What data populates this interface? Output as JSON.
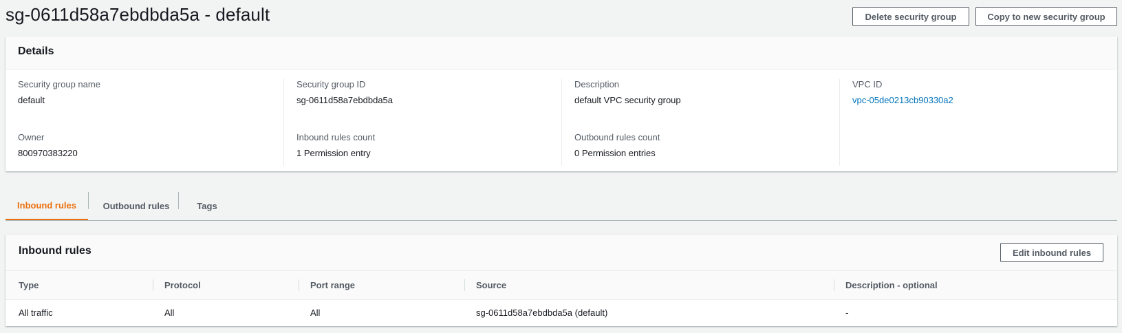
{
  "header": {
    "title": "sg-0611d58a7ebdbda5a - default",
    "delete_label": "Delete security group",
    "copy_label": "Copy to new security group"
  },
  "details": {
    "heading": "Details",
    "fields": {
      "sg_name": {
        "label": "Security group name",
        "value": "default"
      },
      "sg_id": {
        "label": "Security group ID",
        "value": "sg-0611d58a7ebdbda5a"
      },
      "description": {
        "label": "Description",
        "value": "default VPC security group"
      },
      "vpc_id": {
        "label": "VPC ID",
        "value": "vpc-05de0213cb90330a2"
      },
      "owner": {
        "label": "Owner",
        "value": "800970383220"
      },
      "inbound_count": {
        "label": "Inbound rules count",
        "value": "1 Permission entry"
      },
      "outbound_count": {
        "label": "Outbound rules count",
        "value": "0 Permission entries"
      }
    }
  },
  "tabs": [
    {
      "label": "Inbound rules",
      "active": true
    },
    {
      "label": "Outbound rules",
      "active": false
    },
    {
      "label": "Tags",
      "active": false
    }
  ],
  "inbound": {
    "heading": "Inbound rules",
    "edit_label": "Edit inbound rules",
    "columns": [
      "Type",
      "Protocol",
      "Port range",
      "Source",
      "Description - optional"
    ],
    "rows": [
      [
        "All traffic",
        "All",
        "All",
        "sg-0611d58a7ebdbda5a (default)",
        "-"
      ]
    ]
  },
  "colors": {
    "accent": "#ec7211",
    "link": "#0073bb",
    "background": "#f2f3f3"
  }
}
